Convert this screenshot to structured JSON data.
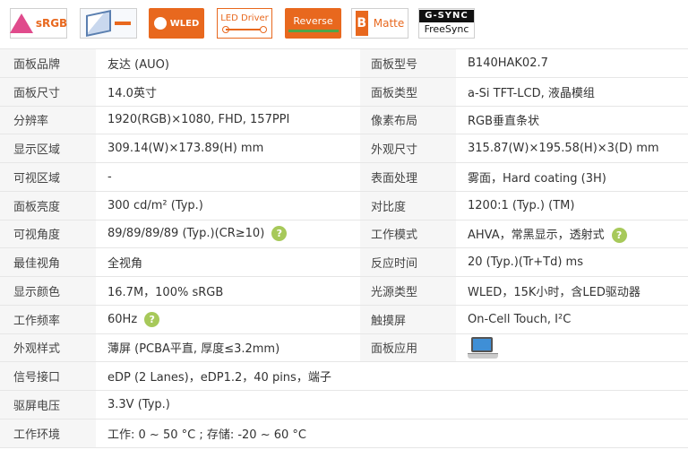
{
  "badges": {
    "srgb": "sRGB",
    "wled": "WLED",
    "led_driver": "LED Driver",
    "reverse": "Reverse",
    "matte_letter": "B",
    "matte": "Matte",
    "gsync_top": "G-SYNC",
    "gsync_bottom": "FreeSync"
  },
  "colors": {
    "accent": "#e8681e",
    "help": "#a7c95a",
    "label_bg": "#f6f6f6"
  },
  "rows": [
    {
      "k1": "面板品牌",
      "v1": "友达 (AUO)",
      "k2": "面板型号",
      "v2": "B140HAK02.7"
    },
    {
      "k1": "面板尺寸",
      "v1": "14.0英寸",
      "k2": "面板类型",
      "v2": "a-Si TFT-LCD, 液晶模组"
    },
    {
      "k1": "分辨率",
      "v1": "1920(RGB)×1080, FHD, 157PPI",
      "k2": "像素布局",
      "v2": "RGB垂直条状"
    },
    {
      "k1": "显示区域",
      "v1": "309.14(W)×173.89(H) mm",
      "k2": "外观尺寸",
      "v2": "315.87(W)×195.58(H)×3(D) mm"
    },
    {
      "k1": "可视区域",
      "v1": "-",
      "k2": "表面处理",
      "v2": "雾面，Hard coating (3H)"
    },
    {
      "k1": "面板亮度",
      "v1": "300 cd/m² (Typ.)",
      "k2": "对比度",
      "v2": "1200:1 (Typ.) (TM)"
    },
    {
      "k1": "可视角度",
      "v1": "89/89/89/89 (Typ.)(CR≥10)",
      "k2": "工作模式",
      "v2": "AHVA，常黑显示，透射式"
    },
    {
      "k1": "最佳视角",
      "v1": "全视角",
      "k2": "反应时间",
      "v2": "20 (Typ.)(Tr+Td) ms"
    },
    {
      "k1": "显示颜色",
      "v1": "16.7M，100% sRGB",
      "k2": "光源类型",
      "v2": "WLED，15K小时，含LED驱动器"
    },
    {
      "k1": "工作频率",
      "v1": "60Hz",
      "k2": "触摸屏",
      "v2": "On-Cell Touch, I²C"
    },
    {
      "k1": "外观样式",
      "v1": "薄屏 (PCBA平直, 厚度≤3.2mm)",
      "k2": "面板应用",
      "v2": ""
    },
    {
      "k1": "信号接口",
      "v1": "eDP (2 Lanes)，eDP1.2，40 pins，端子"
    },
    {
      "k1": "驱屏电压",
      "v1": "3.3V (Typ.)"
    },
    {
      "k1": "工作环境",
      "v1": "工作: 0 ~ 50 °C ; 存储: -20 ~ 60 °C"
    }
  ],
  "help_glyph": "?"
}
